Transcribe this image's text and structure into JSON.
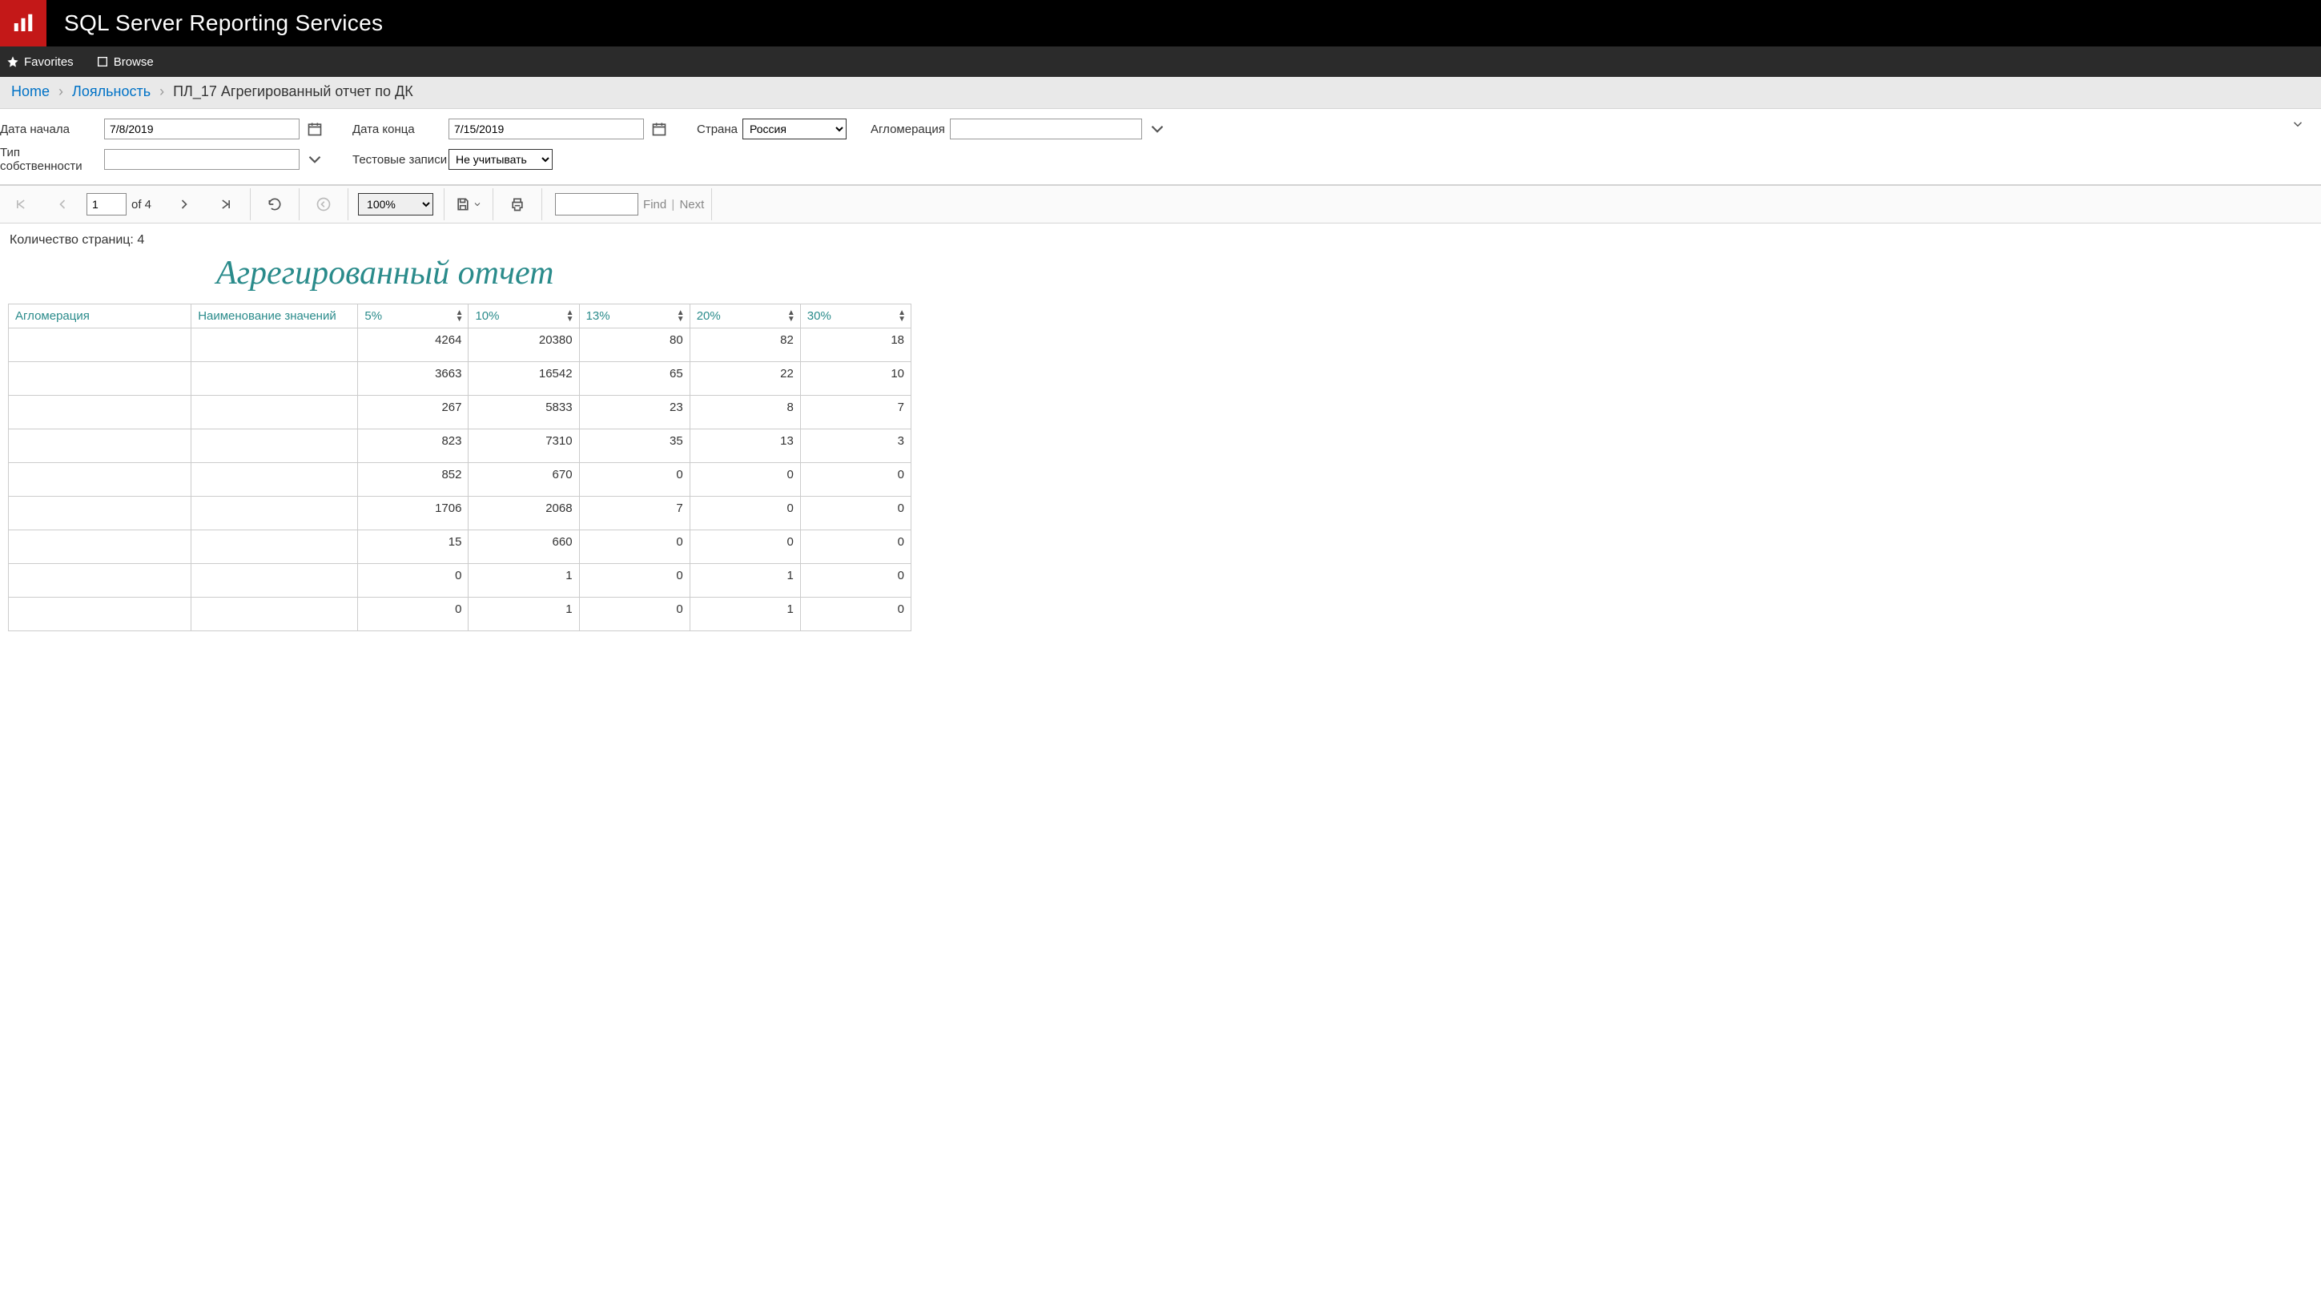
{
  "header": {
    "product_title": "SQL Server Reporting Services",
    "favorites_label": "Favorites",
    "browse_label": "Browse"
  },
  "breadcrumb": {
    "home": "Home",
    "level1": "Лояльность",
    "current": "ПЛ_17 Агрегированный отчет по ДК"
  },
  "params": {
    "date_start_label": "Дата начала",
    "date_start_value": "7/8/2019",
    "date_end_label": "Дата конца",
    "date_end_value": "7/15/2019",
    "country_label": "Страна",
    "country_value": "Россия",
    "agglomeration_label": "Агломерация",
    "agglomeration_value": "",
    "ownership_label": "Тип собственности",
    "ownership_value": "",
    "test_records_label": "Тестовые записи",
    "test_records_value": "Не учитывать"
  },
  "viewer": {
    "page_current": "1",
    "page_total_text": "of 4",
    "zoom": "100%",
    "find_label": "Find",
    "next_label": "Next",
    "find_value": ""
  },
  "report": {
    "page_count_text": "Количество страниц: 4",
    "title": "Агрегированный отчет",
    "columns": {
      "agglomeration": "Агломерация",
      "value_name": "Наименование значений",
      "p5": "5%",
      "p10": "10%",
      "p13": "13%",
      "p20": "20%",
      "p30": "30%"
    }
  },
  "chart_data": {
    "type": "table",
    "columns": [
      "5%",
      "10%",
      "13%",
      "20%",
      "30%"
    ],
    "rows": [
      {
        "values": [
          4264,
          20380,
          80,
          82,
          18
        ]
      },
      {
        "values": [
          3663,
          16542,
          65,
          22,
          10
        ]
      },
      {
        "values": [
          267,
          5833,
          23,
          8,
          7
        ]
      },
      {
        "values": [
          823,
          7310,
          35,
          13,
          3
        ]
      },
      {
        "values": [
          852,
          670,
          0,
          0,
          0
        ]
      },
      {
        "values": [
          1706,
          2068,
          7,
          0,
          0
        ]
      },
      {
        "values": [
          15,
          660,
          0,
          0,
          0
        ]
      },
      {
        "values": [
          0,
          1,
          0,
          1,
          0
        ]
      },
      {
        "values": [
          0,
          1,
          0,
          1,
          0
        ]
      }
    ]
  }
}
